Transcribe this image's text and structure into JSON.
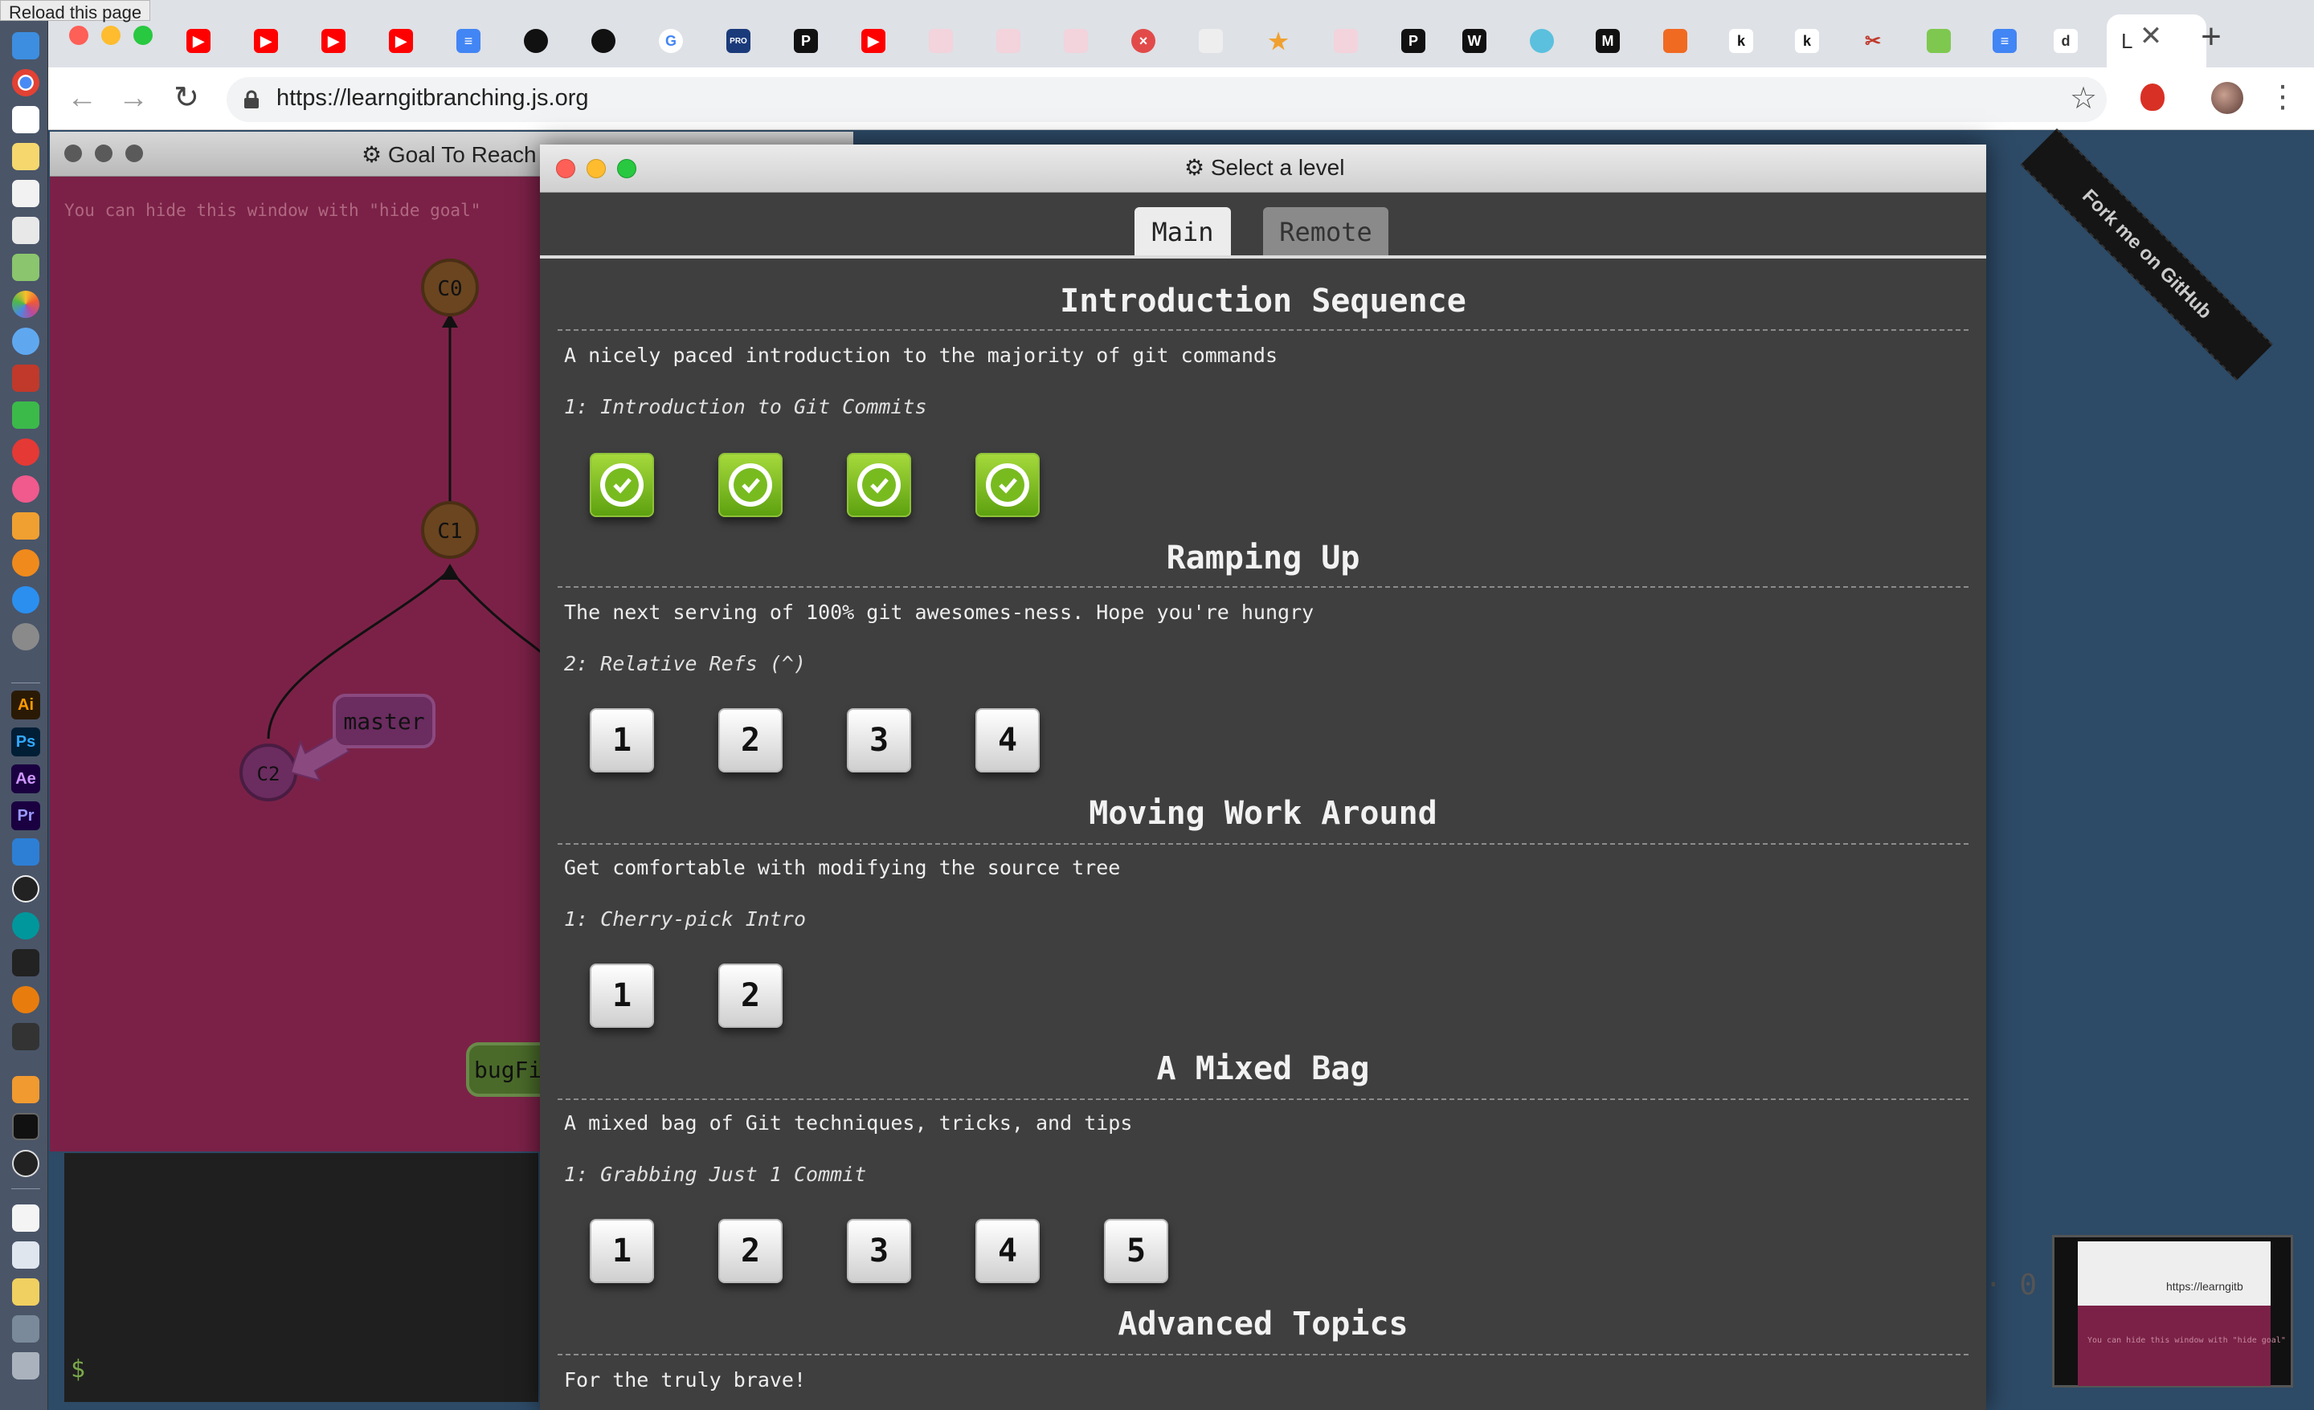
{
  "tooltip": "Reload this page",
  "browser": {
    "url": "https://learngitbranching.js.org",
    "active_tab_label": "L",
    "tab_close": "✕",
    "new_tab": "+",
    "back": "←",
    "forward": "→",
    "reload": "↻",
    "star": "☆",
    "menu": "⋮"
  },
  "goal_window": {
    "title": "⚙ Goal To Reach",
    "hint": "You can hide this window with \"hide goal\"",
    "commits": [
      "C0",
      "C1",
      "C2"
    ],
    "branch_master": "master",
    "branch_partial": "bugFi"
  },
  "terminal": {
    "prompt": "$"
  },
  "page": {
    "fork_ribbon": "Fork me on GitHub",
    "dots": "· 0"
  },
  "thumbnail": {
    "url": "https://learngitb",
    "hint": "You can hide this window with \"hide goal\""
  },
  "modal": {
    "title": "⚙ Select a level",
    "tabs": [
      "Main",
      "Remote"
    ],
    "sequences": [
      {
        "title": "Introduction Sequence",
        "description": "A nicely paced introduction to the majority of git commands",
        "subtitle": "1: Introduction to Git Commits",
        "levels": [
          "✓",
          "✓",
          "✓",
          "✓"
        ],
        "completed": true
      },
      {
        "title": "Ramping Up",
        "description": "The next serving of 100% git awesomes-ness. Hope you're hungry",
        "subtitle": "2: Relative Refs (^)",
        "levels": [
          "1",
          "2",
          "3",
          "4"
        ],
        "completed": false
      },
      {
        "title": "Moving Work Around",
        "description": "Get comfortable with modifying the source tree",
        "subtitle": "1: Cherry-pick Intro",
        "levels": [
          "1",
          "2"
        ],
        "completed": false
      },
      {
        "title": "A Mixed Bag",
        "description": "A mixed bag of Git techniques, tricks, and tips",
        "subtitle": "1: Grabbing Just 1 Commit",
        "levels": [
          "1",
          "2",
          "3",
          "4",
          "5"
        ],
        "completed": false
      },
      {
        "title": "Advanced Topics",
        "description": "For the truly brave!",
        "subtitle": "",
        "levels": [],
        "completed": false
      }
    ]
  },
  "colors": {
    "modal_bg": "#3f3f3f",
    "goal_bg": "#7b2147",
    "page_bg": "#2d4a66",
    "level_done": "#78bb1f"
  }
}
